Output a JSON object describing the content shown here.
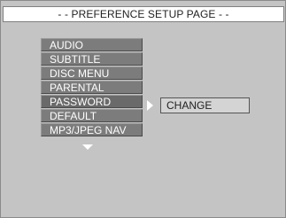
{
  "header": {
    "title": "- - PREFERENCE SETUP PAGE - -"
  },
  "menu": {
    "items": [
      {
        "label": "AUDIO"
      },
      {
        "label": "SUBTITLE"
      },
      {
        "label": "DISC MENU"
      },
      {
        "label": "PARENTAL"
      },
      {
        "label": "PASSWORD",
        "selected": true
      },
      {
        "label": "DEFAULT"
      },
      {
        "label": "MP3/JPEG NAV"
      }
    ]
  },
  "submenu": {
    "items": [
      {
        "label": "CHANGE"
      }
    ]
  },
  "icons": {
    "scroll": "chevron-down-icon",
    "pointer": "arrow-right-icon"
  },
  "colors": {
    "background": "#c4c4c4",
    "item_bg": "#7c7c7c",
    "item_text": "#ffffff",
    "submenu_bg": "#d4d4d4"
  }
}
